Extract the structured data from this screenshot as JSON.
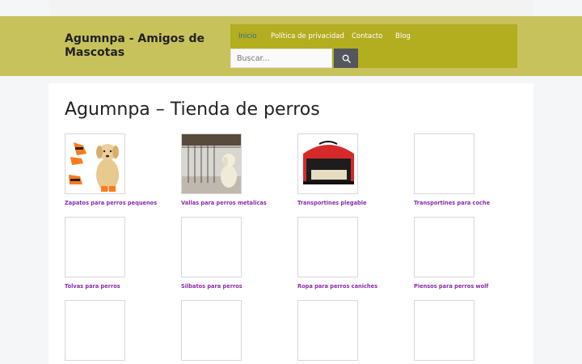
{
  "site": {
    "title": "Agumnpa - Amigos de Mascotas"
  },
  "nav": {
    "items": [
      "Inicio",
      "Política de privacidad",
      "Contacto",
      "Blog"
    ]
  },
  "search": {
    "placeholder": "Buscar..."
  },
  "page": {
    "title": "Agumnpa – Tienda de perros"
  },
  "products": [
    "Zapatos para perros pequenos",
    "Vallas para perros metalicas",
    "Transportines plegable",
    "Transportines para coche",
    "Tolvas para perros",
    "Silbatos para perros",
    "Ropa para perros caniches",
    "Piensos para perros wolf",
    "",
    "",
    "",
    ""
  ],
  "colors": {
    "header_bg": "#c8c25c",
    "nav_bg": "#b3ad20",
    "link": "#8a2ba8",
    "active_nav": "#2a6f8e",
    "search_button": "#55555e"
  }
}
